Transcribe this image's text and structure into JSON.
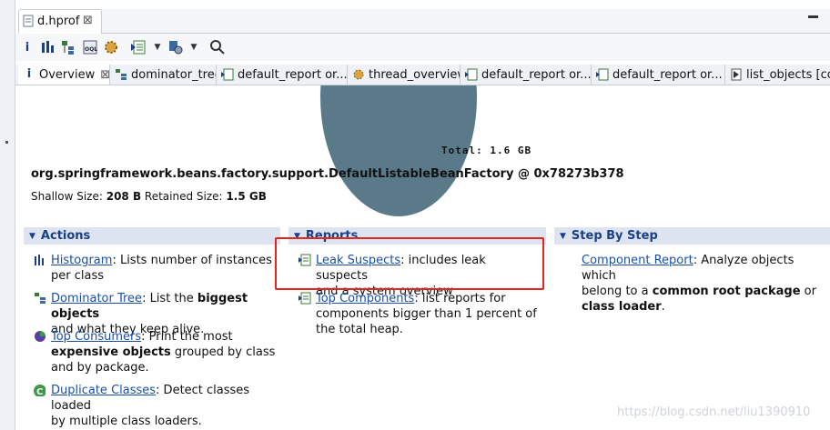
{
  "editor": {
    "tab_label": "d.hprof",
    "close_glyph": "⊠"
  },
  "toolbar": {
    "icons": [
      "info-icon",
      "histogram-icon",
      "dominator-tree-icon",
      "oql-icon",
      "thread-overview-icon",
      "run-report-icon",
      "dropdown-arrow",
      "query-browser-icon",
      "dropdown-arrow",
      "search-icon"
    ]
  },
  "tabs": [
    {
      "label": "Overview",
      "close": "⊠",
      "icon": "info-icon"
    },
    {
      "label": "dominator_tree",
      "icon": "dominator-tree-icon"
    },
    {
      "label": "default_report   or...",
      "icon": "report-icon"
    },
    {
      "label": "thread_overview",
      "icon": "thread-overview-icon"
    },
    {
      "label": "default_report   or...",
      "icon": "report-icon"
    },
    {
      "label": "default_report   or...",
      "icon": "report-icon"
    },
    {
      "label": "list_objects   [cor",
      "icon": "list-objects-icon"
    }
  ],
  "overview": {
    "total_label": "Total: 1.6 GB",
    "object_name": "org.springframework.beans.factory.support.DefaultListableBeanFactory @ 0x78273b378",
    "shallow_label": "Shallow Size:",
    "shallow_value": "208 B",
    "retained_label": "Retained Size:",
    "retained_value": "1.5 GB",
    "pie_color": "#5a7a8a"
  },
  "sections": {
    "actions": {
      "title": "Actions",
      "items": [
        {
          "link": "Histogram",
          "text_a": ": Lists number of instances",
          "text_b": "per class"
        },
        {
          "link": "Dominator Tree",
          "text_a": ": List the ",
          "bold": "biggest objects",
          "text_b": " and what they keep alive."
        },
        {
          "link": "Top Consumers",
          "text_a": ": Print the most",
          "bold": "expensive objects",
          "text_b": " grouped by class",
          "text_c": "and by package."
        },
        {
          "link": "Duplicate Classes",
          "text_a": ": Detect classes loaded",
          "text_b": "by multiple class loaders."
        }
      ]
    },
    "reports": {
      "title": "Reports",
      "items": [
        {
          "link": "Leak Suspects",
          "text_a": ": includes leak suspects",
          "text_b": "and a system overview"
        },
        {
          "link": "Top Components",
          "text_a": ": list reports for",
          "text_b": "components bigger than 1 percent of",
          "text_c": "the total heap."
        }
      ]
    },
    "step": {
      "title": "Step By Step",
      "items": [
        {
          "link": "Component Report",
          "text_a": ": Analyze objects which",
          "text_b": "belong to a ",
          "bold": "common root package",
          "text_c": " or",
          "bold2": "class loader",
          "text_d": "."
        }
      ]
    }
  },
  "highlight_color": "#e2261f",
  "watermark": "https://blog.csdn.net/liu1390910"
}
